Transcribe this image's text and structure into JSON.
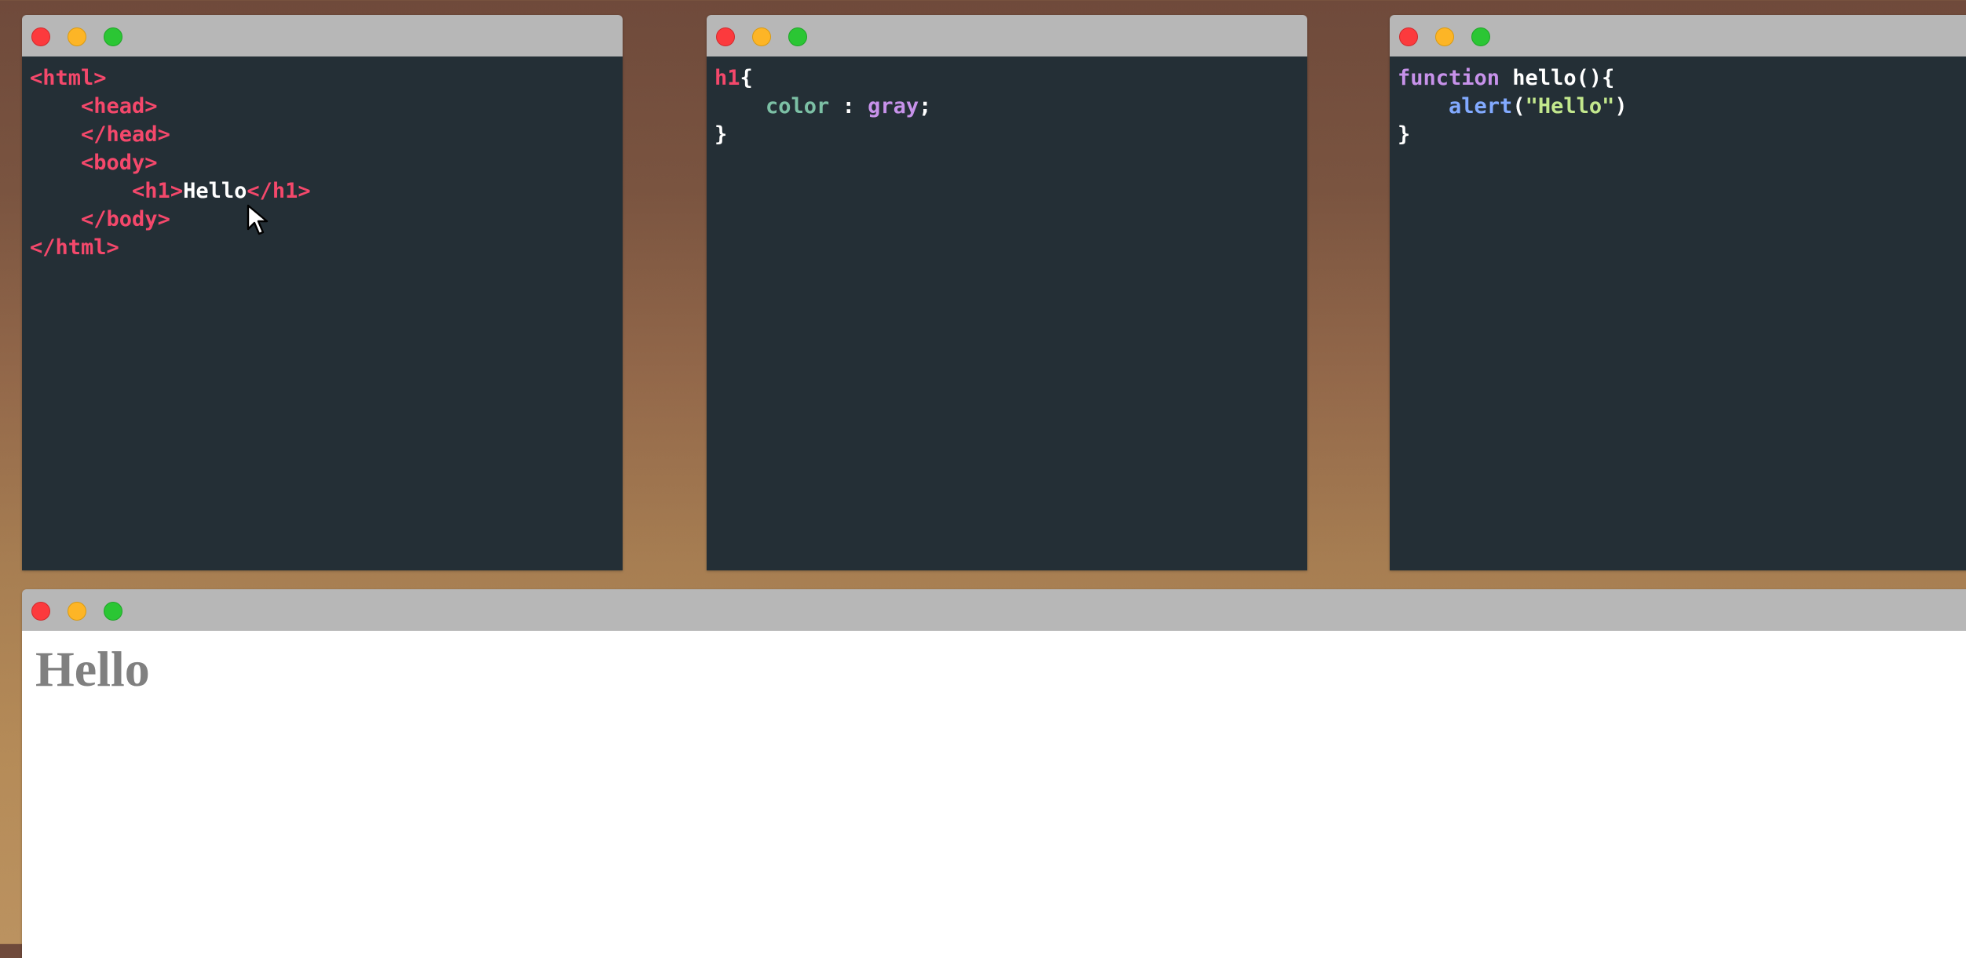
{
  "html_editor": {
    "lines": [
      {
        "indent": "",
        "parts": [
          {
            "t": "<html>",
            "c": "tag"
          }
        ]
      },
      {
        "indent": "    ",
        "parts": [
          {
            "t": "<head>",
            "c": "tag"
          }
        ]
      },
      {
        "indent": "    ",
        "parts": [
          {
            "t": "</head>",
            "c": "tag"
          }
        ]
      },
      {
        "indent": "    ",
        "parts": [
          {
            "t": "<body>",
            "c": "tag"
          }
        ]
      },
      {
        "indent": "        ",
        "parts": [
          {
            "t": "<h1>",
            "c": "tag"
          },
          {
            "t": "Hello",
            "c": "text"
          },
          {
            "t": "</h1>",
            "c": "tag"
          }
        ]
      },
      {
        "indent": "    ",
        "parts": [
          {
            "t": "</body>",
            "c": "tag"
          }
        ]
      },
      {
        "indent": "",
        "parts": [
          {
            "t": "</html>",
            "c": "tag"
          }
        ]
      }
    ]
  },
  "css_editor": {
    "lines": [
      {
        "indent": "",
        "parts": [
          {
            "t": "h1",
            "c": "sel"
          },
          {
            "t": "{",
            "c": "brace"
          }
        ]
      },
      {
        "indent": "    ",
        "parts": [
          {
            "t": "color",
            "c": "prop"
          },
          {
            "t": " : ",
            "c": "colon"
          },
          {
            "t": "gray",
            "c": "value"
          },
          {
            "t": ";",
            "c": "colon"
          }
        ]
      },
      {
        "indent": "",
        "parts": [
          {
            "t": "}",
            "c": "brace"
          }
        ]
      }
    ]
  },
  "js_editor": {
    "lines": [
      {
        "indent": "",
        "parts": [
          {
            "t": "function",
            "c": "kw"
          },
          {
            "t": " hello(){",
            "c": "fn"
          }
        ]
      },
      {
        "indent": "    ",
        "parts": [
          {
            "t": "alert",
            "c": "call"
          },
          {
            "t": "(",
            "c": "fn"
          },
          {
            "t": "\"Hello\"",
            "c": "str"
          },
          {
            "t": ")",
            "c": "fn"
          }
        ]
      },
      {
        "indent": "",
        "parts": [
          {
            "t": "}",
            "c": "brace"
          }
        ]
      }
    ]
  },
  "preview": {
    "heading": "Hello"
  },
  "colors": {
    "tag": "#f4486b",
    "text": "#ffffff",
    "editor_bg": "#242f36",
    "titlebar": "#b7b7b7",
    "preview_heading": "#808080"
  }
}
